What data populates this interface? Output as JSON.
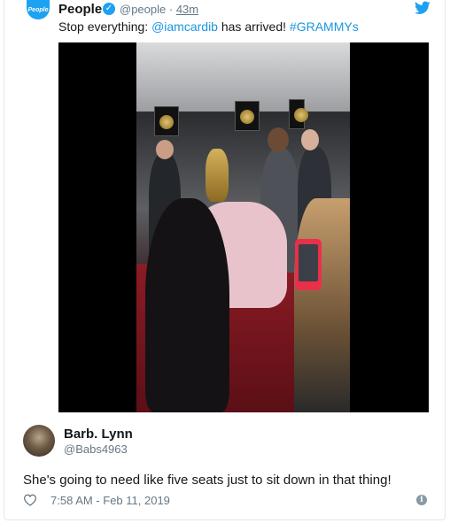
{
  "quoted_tweet": {
    "avatar_text": "People",
    "name": "People",
    "handle": "@people",
    "separator": " · ",
    "time": "43m",
    "text_before": "Stop everything: ",
    "mention": "@iamcardib",
    "text_middle": " has arrived! ",
    "hashtag": "#GRAMMYs"
  },
  "reply": {
    "name": "Barb. Lynn",
    "handle": "@Babs4963",
    "text": "She's going to need like five seats just to sit down in that thing!",
    "date": "7:58 AM - Feb 11, 2019"
  },
  "colors": {
    "link": "#1b95e0",
    "brand": "#1da1f2",
    "muted": "#657786"
  },
  "icons": {
    "verified": "verified-badge-icon",
    "bird": "twitter-bird-icon",
    "heart": "heart-outline-icon",
    "info": "info-icon"
  }
}
